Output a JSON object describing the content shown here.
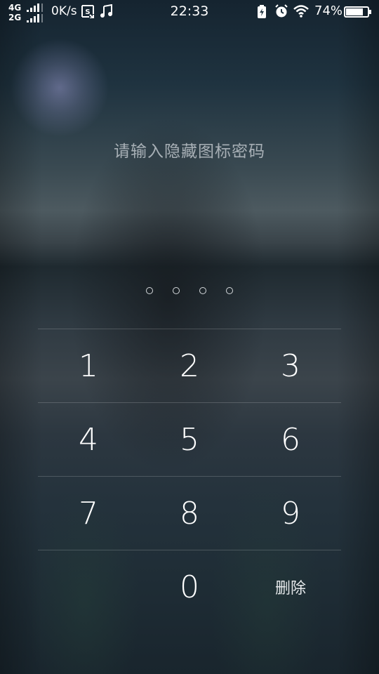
{
  "status_bar": {
    "network_top": "4G",
    "network_bottom": "2G",
    "speed": "0K/s",
    "time": "22:33",
    "battery_percent": "74%",
    "icons": [
      "signal-icon",
      "screenshot-icon",
      "music-icon",
      "charging-icon",
      "alarm-icon",
      "wifi-icon",
      "battery-icon"
    ]
  },
  "lock": {
    "prompt": "请输入隐藏图标密码",
    "pin_length": 4
  },
  "keypad": {
    "k1": "1",
    "k2": "2",
    "k3": "3",
    "k4": "4",
    "k5": "5",
    "k6": "6",
    "k7": "7",
    "k8": "8",
    "k9": "9",
    "k0": "0",
    "delete": "删除"
  },
  "colors": {
    "text": "#ffffff",
    "prompt": "#a8b0b6",
    "divider": "#5a666d"
  }
}
